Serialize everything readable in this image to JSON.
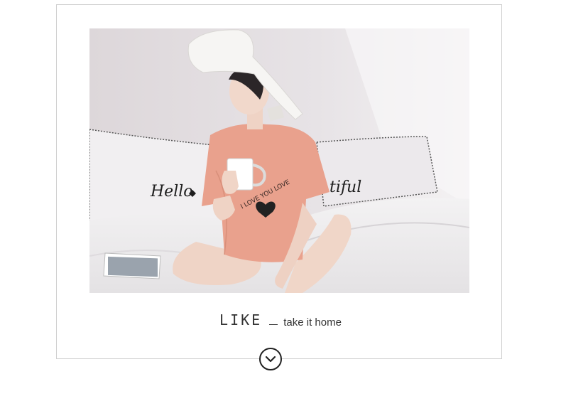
{
  "photo": {
    "pillow_left_text": "Hello",
    "pillow_right_text": "tiful",
    "shirt_text": "I LOVE YOU LOVE"
  },
  "caption": {
    "title": "LIKE",
    "subtitle": "take it home"
  },
  "scroll_button": {
    "icon": "chevron-down-icon"
  },
  "colors": {
    "frame_border": "#cfcfcf",
    "text": "#333333",
    "shirt": "#e9a18d"
  }
}
